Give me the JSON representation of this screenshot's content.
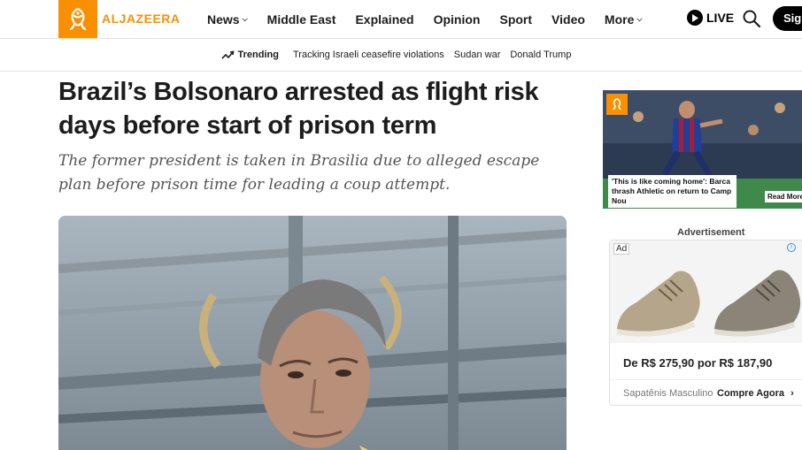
{
  "header": {
    "logo_text": "ALJAZEERA",
    "nav": [
      {
        "label": "News",
        "has_dropdown": true
      },
      {
        "label": "Middle East",
        "has_dropdown": false
      },
      {
        "label": "Explained",
        "has_dropdown": false
      },
      {
        "label": "Opinion",
        "has_dropdown": false
      },
      {
        "label": "Sport",
        "has_dropdown": false
      },
      {
        "label": "Video",
        "has_dropdown": false
      },
      {
        "label": "More",
        "has_dropdown": true
      }
    ],
    "live_label": "LIVE",
    "signin_label": "Sign"
  },
  "trending": {
    "label": "Trending",
    "links": [
      "Tracking Israeli ceasefire violations",
      "Sudan war",
      "Donald Trump"
    ]
  },
  "article": {
    "headline": "Brazil’s Bolsonaro arrested as flight risk days before start of prison term",
    "dek": "The former president is taken in Brasilia due to alleged escape plan before prison time for leading a coup attempt."
  },
  "sidebar_video": {
    "caption": "'This is like coming home': Barca thrash Athletic on return to Camp Nou",
    "more_label": "Read More"
  },
  "ad": {
    "section_label": "Advertisement",
    "tag": "Ad",
    "price_text": "De R$ 275,90 por R$ 187,90",
    "brand": "Sapatênis Masculino",
    "cta": "Compre Agora"
  },
  "colors": {
    "brand": "#fa9000",
    "text": "#1c1c1c",
    "dek": "#555555"
  }
}
